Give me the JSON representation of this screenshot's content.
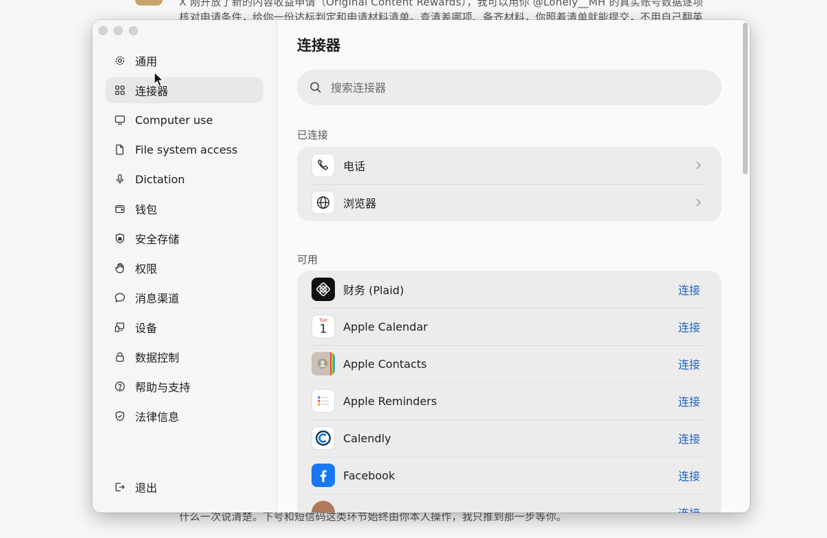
{
  "background": {
    "line1": "X 刚开放了新的内容收益申请（Original Content Rewards），我可以用你 @Lonely__MH 的真实账号数据逐项",
    "line2": "核对申请条件，给你一份达标判定和申请材料清单。查清差哪项、备齐材料，你照着清单就能提交，不用自己翻英",
    "line3": "什么一次说清楚。下号和短信码这类环节始终由你本人操作，我只推到那一步等你。"
  },
  "sidebar": {
    "items": [
      {
        "label": "通用",
        "icon": "gear-icon"
      },
      {
        "label": "连接器",
        "icon": "grid-icon"
      },
      {
        "label": "Computer use",
        "icon": "monitor-icon"
      },
      {
        "label": "File system access",
        "icon": "file-icon"
      },
      {
        "label": "Dictation",
        "icon": "microphone-icon"
      },
      {
        "label": "钱包",
        "icon": "wallet-icon"
      },
      {
        "label": "安全存储",
        "icon": "shield-lock-icon"
      },
      {
        "label": "权限",
        "icon": "hand-icon"
      },
      {
        "label": "消息渠道",
        "icon": "chat-bubble-icon"
      },
      {
        "label": "设备",
        "icon": "devices-icon"
      },
      {
        "label": "数据控制",
        "icon": "lock-icon"
      },
      {
        "label": "帮助与支持",
        "icon": "help-circle-icon"
      },
      {
        "label": "法律信息",
        "icon": "shield-check-icon"
      }
    ],
    "active_index": 1,
    "logout_label": "退出"
  },
  "main": {
    "title": "连接器",
    "search_placeholder": "搜索连接器",
    "connected_label": "已连接",
    "connected": [
      {
        "name": "电话",
        "icon": "phone-icon"
      },
      {
        "name": "浏览器",
        "icon": "globe-icon"
      }
    ],
    "available_label": "可用",
    "available": [
      {
        "name": "财务 (Plaid)",
        "icon": "plaid-icon",
        "action": "连接"
      },
      {
        "name": "Apple Calendar",
        "icon": "calendar-icon",
        "action": "连接",
        "icon_day": "Tue",
        "icon_date": "1"
      },
      {
        "name": "Apple Contacts",
        "icon": "contacts-icon",
        "action": "连接"
      },
      {
        "name": "Apple Reminders",
        "icon": "reminders-icon",
        "action": "连接"
      },
      {
        "name": "Calendly",
        "icon": "calendly-icon",
        "action": "连接"
      },
      {
        "name": "Facebook",
        "icon": "facebook-icon",
        "action": "连接"
      },
      {
        "name": "",
        "icon": "partial-app-icon",
        "action": "连接"
      }
    ]
  },
  "colors": {
    "accent": "#1f63c6",
    "facebook": "#1877f2",
    "plaid": "#111111"
  }
}
